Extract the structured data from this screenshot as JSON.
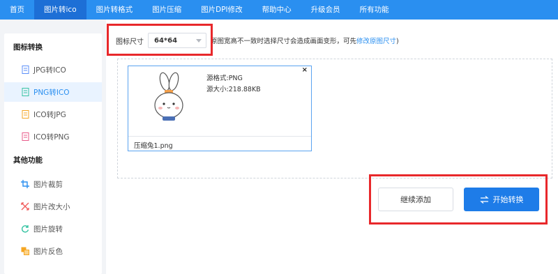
{
  "nav": {
    "items": [
      {
        "label": "首页"
      },
      {
        "label": "图片转ico"
      },
      {
        "label": "图片转格式"
      },
      {
        "label": "图片压缩"
      },
      {
        "label": "图片DPI修改"
      },
      {
        "label": "帮助中心"
      },
      {
        "label": "升级会员"
      },
      {
        "label": "所有功能"
      }
    ],
    "active_index": 1,
    "bg_color": "#2a8ff0"
  },
  "sidebar": {
    "group1_title": "图标转换",
    "group1_items": [
      {
        "label": "JPG转ICO",
        "icon": "document-icon"
      },
      {
        "label": "PNG转ICO",
        "icon": "document-icon"
      },
      {
        "label": "ICO转JPG",
        "icon": "document-icon"
      },
      {
        "label": "ICO转PNG",
        "icon": "document-icon"
      }
    ],
    "group2_title": "其他功能",
    "group2_items": [
      {
        "label": "图片裁剪",
        "icon": "crop-icon"
      },
      {
        "label": "图片改大小",
        "icon": "resize-icon"
      },
      {
        "label": "图片旋转",
        "icon": "rotate-icon"
      },
      {
        "label": "图片反色",
        "icon": "invert-icon"
      }
    ],
    "active_label": "PNG转ICO"
  },
  "settings": {
    "size_label": "图标尺寸",
    "size_value": "64*64",
    "hint_text": "原图宽高不一致时选择尺寸会造成画面变形，可先",
    "hint_link": "修改原图尺寸",
    "hint_tail": ")"
  },
  "file": {
    "format_text": "源格式:PNG",
    "size_text": "源大小:218.88KB",
    "name": "压缩兔1.png",
    "close_glyph": "×"
  },
  "buttons": {
    "continue_label": "继续添加",
    "start_label": "开始转换"
  },
  "colors": {
    "accent": "#2a8ff0",
    "highlight_red": "#e8282b",
    "start_button": "#1e7ce8"
  }
}
